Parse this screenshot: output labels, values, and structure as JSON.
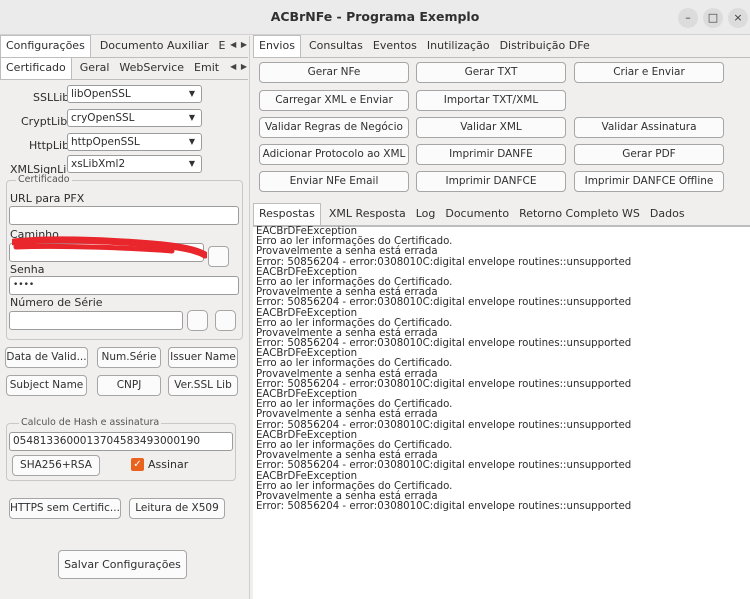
{
  "window": {
    "title": "ACBrNFe - Programa Exemplo",
    "controls": [
      "–",
      "□",
      "×"
    ]
  },
  "left": {
    "tabs": [
      "Configurações",
      "Documento Auxiliar",
      "E"
    ],
    "subtabs": [
      "Certificado",
      "Geral",
      "WebService",
      "Emit"
    ],
    "fields": {
      "ssllib": {
        "label": "SSLLib",
        "value": "libOpenSSL"
      },
      "cryptlib": {
        "label": "CryptLib",
        "value": "cryOpenSSL"
      },
      "httplib": {
        "label": "HttpLib",
        "value": "httpOpenSSL"
      },
      "xmlsignlib": {
        "label": "XMLSignLi",
        "value": "xsLibXml2"
      }
    },
    "cert_group": {
      "title": "Certificado",
      "url_label": "URL para PFX",
      "url_value": "",
      "path_label": "Caminho",
      "path_value": "",
      "password_label": "Senha",
      "password_value": "••••",
      "serial_label": "Número de Série",
      "serial_value": ""
    },
    "buttons": {
      "data_valid": "Data de Valid...",
      "num_serie": "Num.Série",
      "issuer_name": "Issuer Name",
      "subject_name": "Subject Name",
      "cnpj": "CNPJ",
      "ver_ssl_lib": "Ver.SSL Lib"
    },
    "hash_group": {
      "title": "Calculo de Hash e assinatura",
      "value": "05481336000137045834930001​90",
      "sha_button": "SHA256+RSA",
      "sign_checkbox": {
        "label": "Assinar",
        "checked": true
      }
    },
    "https_button": "HTTPS sem Certific...",
    "x509_button": "Leitura de X509",
    "save_button": "Salvar Configurações"
  },
  "right": {
    "tabs": [
      "Envios",
      "Consultas",
      "Eventos",
      "Inutilização",
      "Distribuição DFe"
    ],
    "actions": [
      [
        "Gerar NFe",
        "Gerar TXT",
        "Criar e Enviar"
      ],
      [
        "Carregar XML e Enviar",
        "Importar TXT/XML"
      ],
      [
        "Validar Regras de Negócio",
        "Validar XML",
        "Validar Assinatura"
      ],
      [
        "Adicionar Protocolo ao XML",
        "Imprimir DANFE",
        "Gerar PDF"
      ],
      [
        "Enviar NFe Email",
        "Imprimir DANFCE",
        "Imprimir DANFCE Offline"
      ]
    ],
    "result_tabs": [
      "Respostas",
      "XML Resposta",
      "Log",
      "Documento",
      "Retorno Completo WS",
      "Dados"
    ],
    "log_lines": [
      "EACBrDFeException",
      "Erro ao ler informações do Certificado.",
      "Provavelmente a senha está errada",
      "Error: 50856204 - error:0308010C:digital envelope routines::unsupported",
      "EACBrDFeException",
      "Erro ao ler informações do Certificado.",
      "Provavelmente a senha está errada",
      "Error: 50856204 - error:0308010C:digital envelope routines::unsupported",
      "EACBrDFeException",
      "Erro ao ler informações do Certificado.",
      "Provavelmente a senha está errada",
      "Error: 50856204 - error:0308010C:digital envelope routines::unsupported",
      "EACBrDFeException",
      "Erro ao ler informações do Certificado.",
      "Provavelmente a senha está errada",
      "Error: 50856204 - error:0308010C:digital envelope routines::unsupported",
      "EACBrDFeException",
      "Erro ao ler informações do Certificado.",
      "Provavelmente a senha está errada",
      "Error: 50856204 - error:0308010C:digital envelope routines::unsupported",
      "EACBrDFeException",
      "Erro ao ler informações do Certificado.",
      "Provavelmente a senha está errada",
      "Error: 50856204 - error:0308010C:digital envelope routines::unsupported",
      "EACBrDFeException",
      "Erro ao ler informações do Certificado.",
      "Provavelmente a senha está errada",
      "Error: 50856204 - error:0308010C:digital envelope routines::unsupported"
    ]
  },
  "colors": {
    "accent": "#e9631f",
    "redaction": "#e8262b"
  }
}
